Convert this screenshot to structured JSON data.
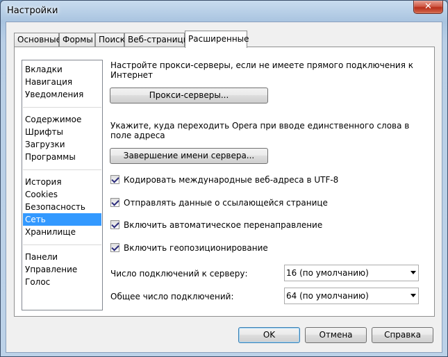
{
  "window": {
    "title": "Настройки",
    "close_glyph": "✕"
  },
  "tabs": [
    {
      "label": "Основные",
      "active": false
    },
    {
      "label": "Формы",
      "active": false
    },
    {
      "label": "Поиск",
      "active": false
    },
    {
      "label": "Веб-страницы",
      "active": false
    },
    {
      "label": "Расширенные",
      "active": true
    }
  ],
  "sidebar": {
    "groups": [
      [
        "Вкладки",
        "Навигация",
        "Уведомления"
      ],
      [
        "Содержимое",
        "Шрифты",
        "Загрузки",
        "Программы"
      ],
      [
        "История",
        "Cookies",
        "Безопасность",
        "Сеть",
        "Хранилище"
      ],
      [
        "Панели",
        "Управление",
        "Голос"
      ]
    ],
    "selected": "Сеть"
  },
  "network": {
    "proxy_desc_line1": "Настройте прокси-серверы, если не имеете прямого подключения к",
    "proxy_desc_line2": "Интернет",
    "proxy_button": "Прокси-серверы...",
    "completion_desc_line1": "Укажите, куда переходить Opera при вводе единственного слова в",
    "completion_desc_line2": "поле адреса",
    "completion_button": "Завершение имени сервера...",
    "checkboxes": [
      {
        "label": "Кодировать международные веб-адреса в UTF-8",
        "checked": true
      },
      {
        "label": "Отправлять данные о ссылающейся странице",
        "checked": true
      },
      {
        "label": "Включить автоматическое перенаправление",
        "checked": true
      },
      {
        "label": "Включить геопозиционирование",
        "checked": true
      }
    ],
    "server_connections_label": "Число подключений к серверу:",
    "server_connections_value": "16 (по умолчанию)",
    "total_connections_label": "Общее число подключений:",
    "total_connections_value": "64 (по умолчанию)"
  },
  "footer": {
    "ok": "OK",
    "cancel": "Отмена",
    "help": "Справка"
  }
}
